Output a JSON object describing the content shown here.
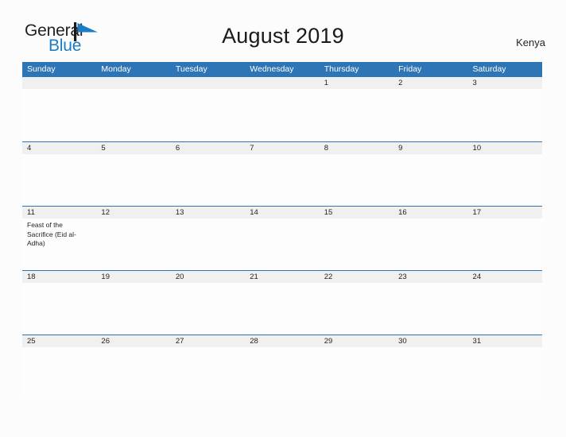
{
  "brand": {
    "word_one": "General",
    "word_two": "Blue",
    "flag_icon": "blue-pennant-icon",
    "dark_color": "#231f20",
    "blue_color": "#1d7dc4"
  },
  "header": {
    "title": "August 2019",
    "region": "Kenya"
  },
  "theme": {
    "header_blue": "#2e75b6",
    "date_band_gray": "#f0f0f0",
    "page_background": "#fcfcfd",
    "text_color": "#231f20"
  },
  "calendar": {
    "month": "August",
    "year": "2019",
    "weekdays": [
      "Sunday",
      "Monday",
      "Tuesday",
      "Wednesday",
      "Thursday",
      "Friday",
      "Saturday"
    ],
    "weeks": [
      {
        "days": [
          {
            "num": "",
            "event": ""
          },
          {
            "num": "",
            "event": ""
          },
          {
            "num": "",
            "event": ""
          },
          {
            "num": "",
            "event": ""
          },
          {
            "num": "1",
            "event": ""
          },
          {
            "num": "2",
            "event": ""
          },
          {
            "num": "3",
            "event": ""
          }
        ]
      },
      {
        "days": [
          {
            "num": "4",
            "event": ""
          },
          {
            "num": "5",
            "event": ""
          },
          {
            "num": "6",
            "event": ""
          },
          {
            "num": "7",
            "event": ""
          },
          {
            "num": "8",
            "event": ""
          },
          {
            "num": "9",
            "event": ""
          },
          {
            "num": "10",
            "event": ""
          }
        ]
      },
      {
        "days": [
          {
            "num": "11",
            "event": "Feast of the Sacrifice (Eid al-Adha)"
          },
          {
            "num": "12",
            "event": ""
          },
          {
            "num": "13",
            "event": ""
          },
          {
            "num": "14",
            "event": ""
          },
          {
            "num": "15",
            "event": ""
          },
          {
            "num": "16",
            "event": ""
          },
          {
            "num": "17",
            "event": ""
          }
        ]
      },
      {
        "days": [
          {
            "num": "18",
            "event": ""
          },
          {
            "num": "19",
            "event": ""
          },
          {
            "num": "20",
            "event": ""
          },
          {
            "num": "21",
            "event": ""
          },
          {
            "num": "22",
            "event": ""
          },
          {
            "num": "23",
            "event": ""
          },
          {
            "num": "24",
            "event": ""
          }
        ]
      },
      {
        "days": [
          {
            "num": "25",
            "event": ""
          },
          {
            "num": "26",
            "event": ""
          },
          {
            "num": "27",
            "event": ""
          },
          {
            "num": "28",
            "event": ""
          },
          {
            "num": "29",
            "event": ""
          },
          {
            "num": "30",
            "event": ""
          },
          {
            "num": "31",
            "event": ""
          }
        ]
      }
    ]
  }
}
